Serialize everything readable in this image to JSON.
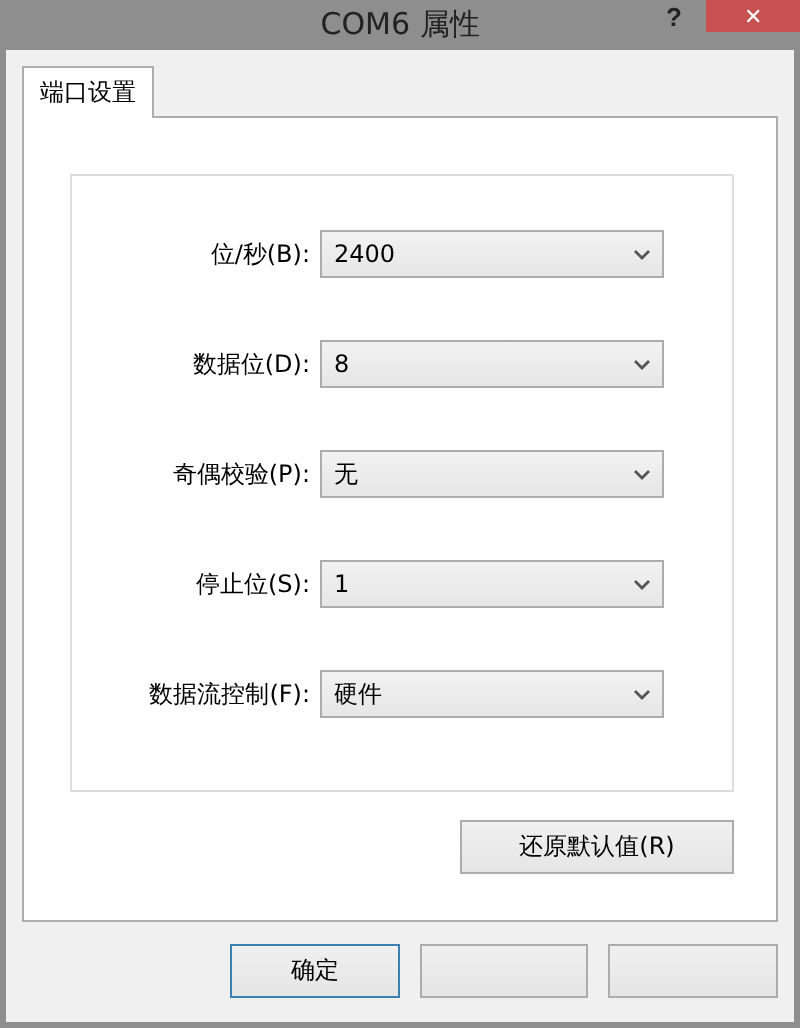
{
  "window": {
    "title": "COM6 属性",
    "help": "?",
    "close": "✕"
  },
  "tabs": [
    {
      "label": "端口设置",
      "selected": true
    }
  ],
  "fields": [
    {
      "label": "位/秒(B):",
      "value": "2400"
    },
    {
      "label": "数据位(D):",
      "value": "8"
    },
    {
      "label": "奇偶校验(P):",
      "value": "无"
    },
    {
      "label": "停止位(S):",
      "value": "1"
    },
    {
      "label": "数据流控制(F):",
      "value": "硬件"
    }
  ],
  "restore_button": "还原默认值(R)",
  "buttons": [
    {
      "label": "确定",
      "default": true
    },
    {
      "default": false
    },
    {
      "default": false
    }
  ]
}
